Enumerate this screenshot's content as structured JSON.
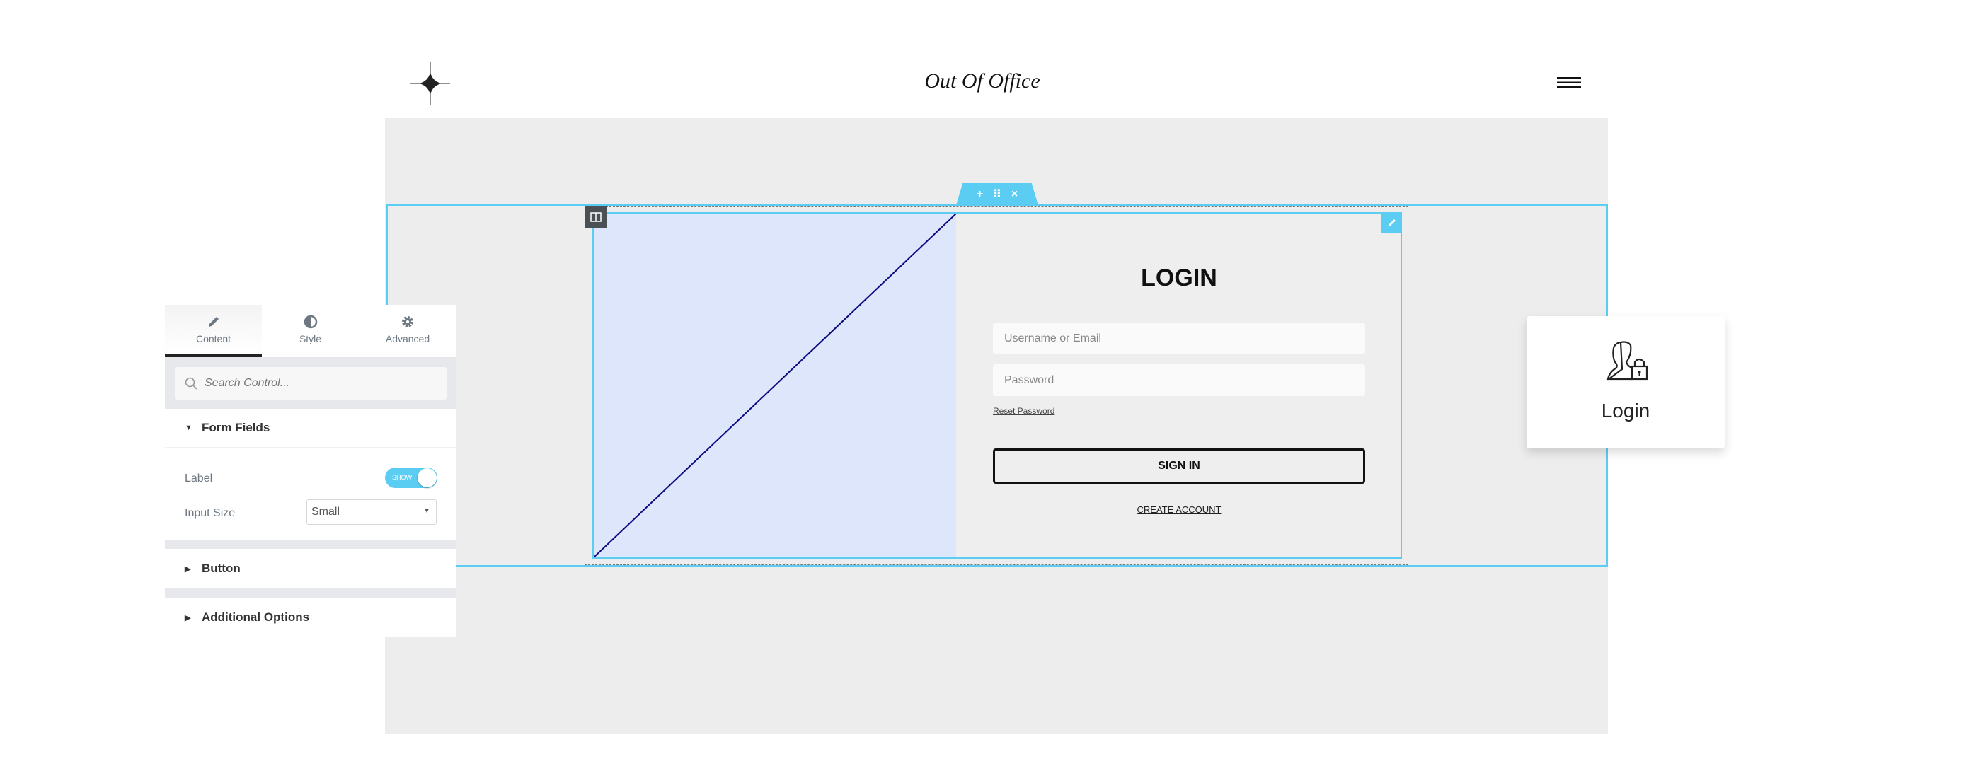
{
  "header": {
    "title": "Out Of Office",
    "logo_icon": "four-point-star-icon",
    "menu_icon": "hamburger-icon"
  },
  "editor": {
    "accent": "#5bcdf2",
    "section_handle": {
      "add": "+",
      "drag": "⠿",
      "close": "×"
    }
  },
  "login_form": {
    "title": "LOGIN",
    "username_placeholder": "Username or Email",
    "password_placeholder": "Password",
    "reset_link": "Reset Password",
    "submit_label": "SIGN IN",
    "create_link": "CREATE ACCOUNT"
  },
  "widget_card": {
    "icon": "user-lock-icon",
    "label": "Login"
  },
  "panel": {
    "tabs": [
      {
        "label": "Content",
        "icon": "pencil-icon"
      },
      {
        "label": "Style",
        "icon": "contrast-icon"
      },
      {
        "label": "Advanced",
        "icon": "gear-icon"
      }
    ],
    "search_placeholder": "Search Control...",
    "sections": {
      "form_fields": "Form Fields",
      "button": "Button",
      "additional": "Additional Options"
    },
    "label_row": {
      "label": "Label",
      "toggle_text": "SHOW",
      "toggle_on": true
    },
    "input_size": {
      "label": "Input Size",
      "value": "Small"
    }
  }
}
